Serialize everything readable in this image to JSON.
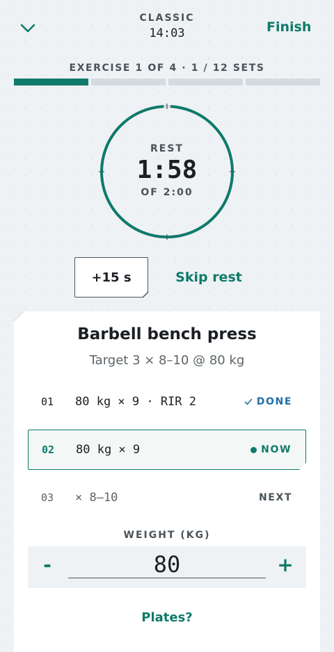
{
  "header": {
    "mode": "CLASSIC",
    "clock": "14:03",
    "finish_label": "Finish",
    "collapse_icon": "chevron-down-icon"
  },
  "progress": {
    "text": "EXERCISE 1 OF 4 · 1 / 12 SETS",
    "segments_total": 4,
    "segments_active": 1
  },
  "rest": {
    "label": "REST",
    "time": "1:58",
    "of_label": "OF 2:00",
    "remaining_fraction": 0.983
  },
  "controls": {
    "add_time_label": "+15 s",
    "skip_label": "Skip rest"
  },
  "exercise": {
    "title": "Barbell bench press",
    "target": "Target 3 × 8–10 @ 80 kg",
    "sets": [
      {
        "num": "01",
        "detail": "80 kg × 9 · RIR 2",
        "status": "DONE",
        "status_icon": "check-icon"
      },
      {
        "num": "02",
        "detail": "80 kg × 9",
        "status": "NOW",
        "status_icon": "dot-icon"
      },
      {
        "num": "03",
        "detail": "× 8–10",
        "status": "NEXT"
      }
    ]
  },
  "weight": {
    "label": "WEIGHT (KG)",
    "value": "80",
    "minus_label": "-",
    "plus_label": "+"
  },
  "plates_label": "Plates?",
  "colors": {
    "accent": "#0f7a6a",
    "done": "#1f6fa8",
    "background": "#eef2f5",
    "track": "#d4dbe0"
  }
}
